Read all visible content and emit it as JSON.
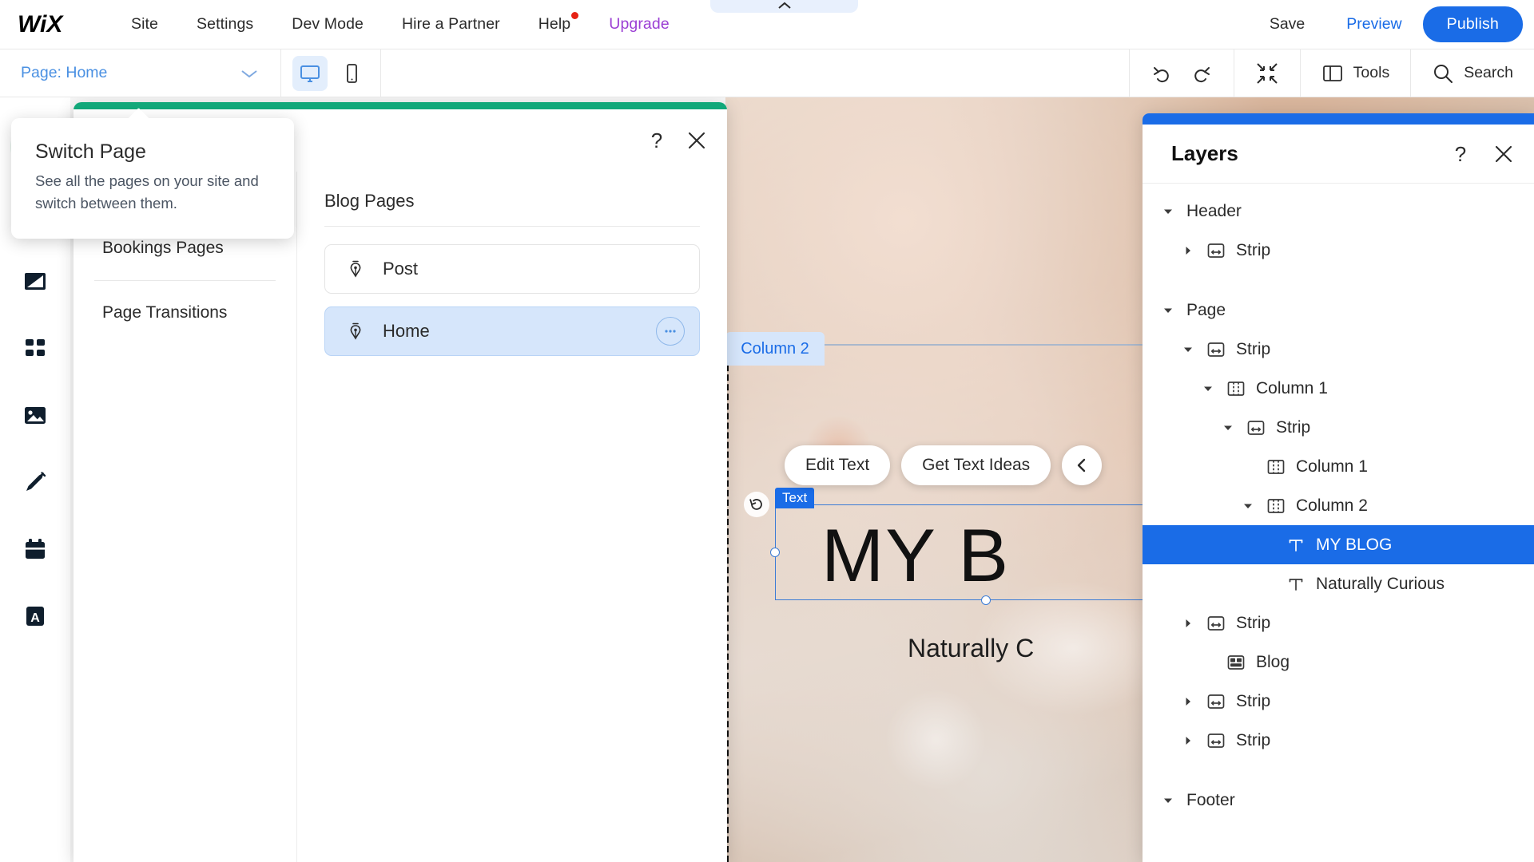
{
  "topbar": {
    "logo": "WIX",
    "nav": [
      {
        "label": "Site"
      },
      {
        "label": "Settings"
      },
      {
        "label": "Dev Mode"
      },
      {
        "label": "Help",
        "badge": true
      },
      {
        "label": "Upgrade",
        "accent": true
      }
    ],
    "hire_label": "Hire a Partner",
    "save_label": "Save",
    "preview_label": "Preview",
    "publish_label": "Publish",
    "accent_blue": "#1a6ce7",
    "upgrade_purple": "#9b3fd4",
    "help_badge_color": "#e62214"
  },
  "subbar": {
    "page_label": "Page: Home",
    "desktop_icon": "desktop-icon",
    "mobile_icon": "mobile-icon",
    "undo_icon": "undo-icon",
    "redo_icon": "redo-icon",
    "zoomout_icon": "zoom-out-icon",
    "tools_label": "Tools",
    "search_label": "Search"
  },
  "rail": {
    "items": [
      {
        "icon": "add-plus-icon",
        "name": "add-elements"
      },
      {
        "icon": "theme-paint-icon",
        "name": "site-design"
      },
      {
        "icon": "background-icon",
        "name": "background"
      },
      {
        "icon": "apps-grid-icon",
        "name": "app-market"
      },
      {
        "icon": "media-image-icon",
        "name": "my-uploads"
      },
      {
        "icon": "pen-nib-icon",
        "name": "blog"
      },
      {
        "icon": "calendar-icon",
        "name": "bookings"
      },
      {
        "icon": "ascend-icon",
        "name": "ascend"
      }
    ]
  },
  "tooltip": {
    "title": "Switch Page",
    "body": "See all the pages on your site and switch between them."
  },
  "pages_dialog": {
    "help_icon": "question-mark-icon",
    "close_icon": "close-icon",
    "menu": [
      {
        "label": "Blog Pages",
        "selected": true,
        "gear": true
      },
      {
        "label": "Bookings Pages",
        "selected": false,
        "gear": false
      },
      {
        "label": "Page Transitions",
        "selected": false,
        "gear": false
      }
    ],
    "section_title": "Blog Pages",
    "pages": [
      {
        "name": "Post",
        "icon": "pen-nib-icon",
        "selected": false,
        "more": false
      },
      {
        "name": "Home",
        "icon": "pen-nib-icon",
        "selected": true,
        "more": true
      }
    ]
  },
  "canvas": {
    "column_tag": "Column 2",
    "text_tag": "Text",
    "hero_title": "MY B",
    "hero_subtitle": "Naturally C",
    "toolbar": [
      {
        "label": "Edit Text"
      },
      {
        "label": "Get Text Ideas"
      }
    ],
    "rotate_icon": "rotate-icon",
    "more_icon": "ellipsis-icon"
  },
  "layers": {
    "title": "Layers",
    "help_icon": "question-mark-icon",
    "close_icon": "close-icon",
    "tree": [
      {
        "label": "Header",
        "indent": 0,
        "caret": "down",
        "icon": null
      },
      {
        "label": "Strip",
        "indent": 1,
        "caret": "right",
        "icon": "strip-icon"
      },
      {
        "label": "",
        "indent": 0,
        "caret": null,
        "icon": null,
        "spacer": true
      },
      {
        "label": "Page",
        "indent": 0,
        "caret": "down",
        "icon": null
      },
      {
        "label": "Strip",
        "indent": 1,
        "caret": "down",
        "icon": "strip-icon"
      },
      {
        "label": "Column 1",
        "indent": 2,
        "caret": "down",
        "icon": "column-icon"
      },
      {
        "label": "Strip",
        "indent": 3,
        "caret": "down",
        "icon": "strip-icon"
      },
      {
        "label": "Column 1",
        "indent": 4,
        "caret": null,
        "icon": "column-icon"
      },
      {
        "label": "Column 2",
        "indent": 4,
        "caret": "down",
        "icon": "column-icon"
      },
      {
        "label": "MY BLOG",
        "indent": 5,
        "caret": null,
        "icon": "text-icon",
        "selected": true
      },
      {
        "label": "Naturally Curious",
        "indent": 5,
        "caret": null,
        "icon": "text-icon"
      },
      {
        "label": "Strip",
        "indent": 1,
        "caret": "right",
        "icon": "strip-icon"
      },
      {
        "label": "Blog",
        "indent": 2,
        "caret": null,
        "icon": "blog-app-icon"
      },
      {
        "label": "Strip",
        "indent": 1,
        "caret": "right",
        "icon": "strip-icon"
      },
      {
        "label": "Strip",
        "indent": 1,
        "caret": "right",
        "icon": "strip-icon"
      },
      {
        "label": "",
        "indent": 0,
        "caret": null,
        "icon": null,
        "spacer": true
      },
      {
        "label": "Footer",
        "indent": 0,
        "caret": "down",
        "icon": null
      }
    ]
  }
}
